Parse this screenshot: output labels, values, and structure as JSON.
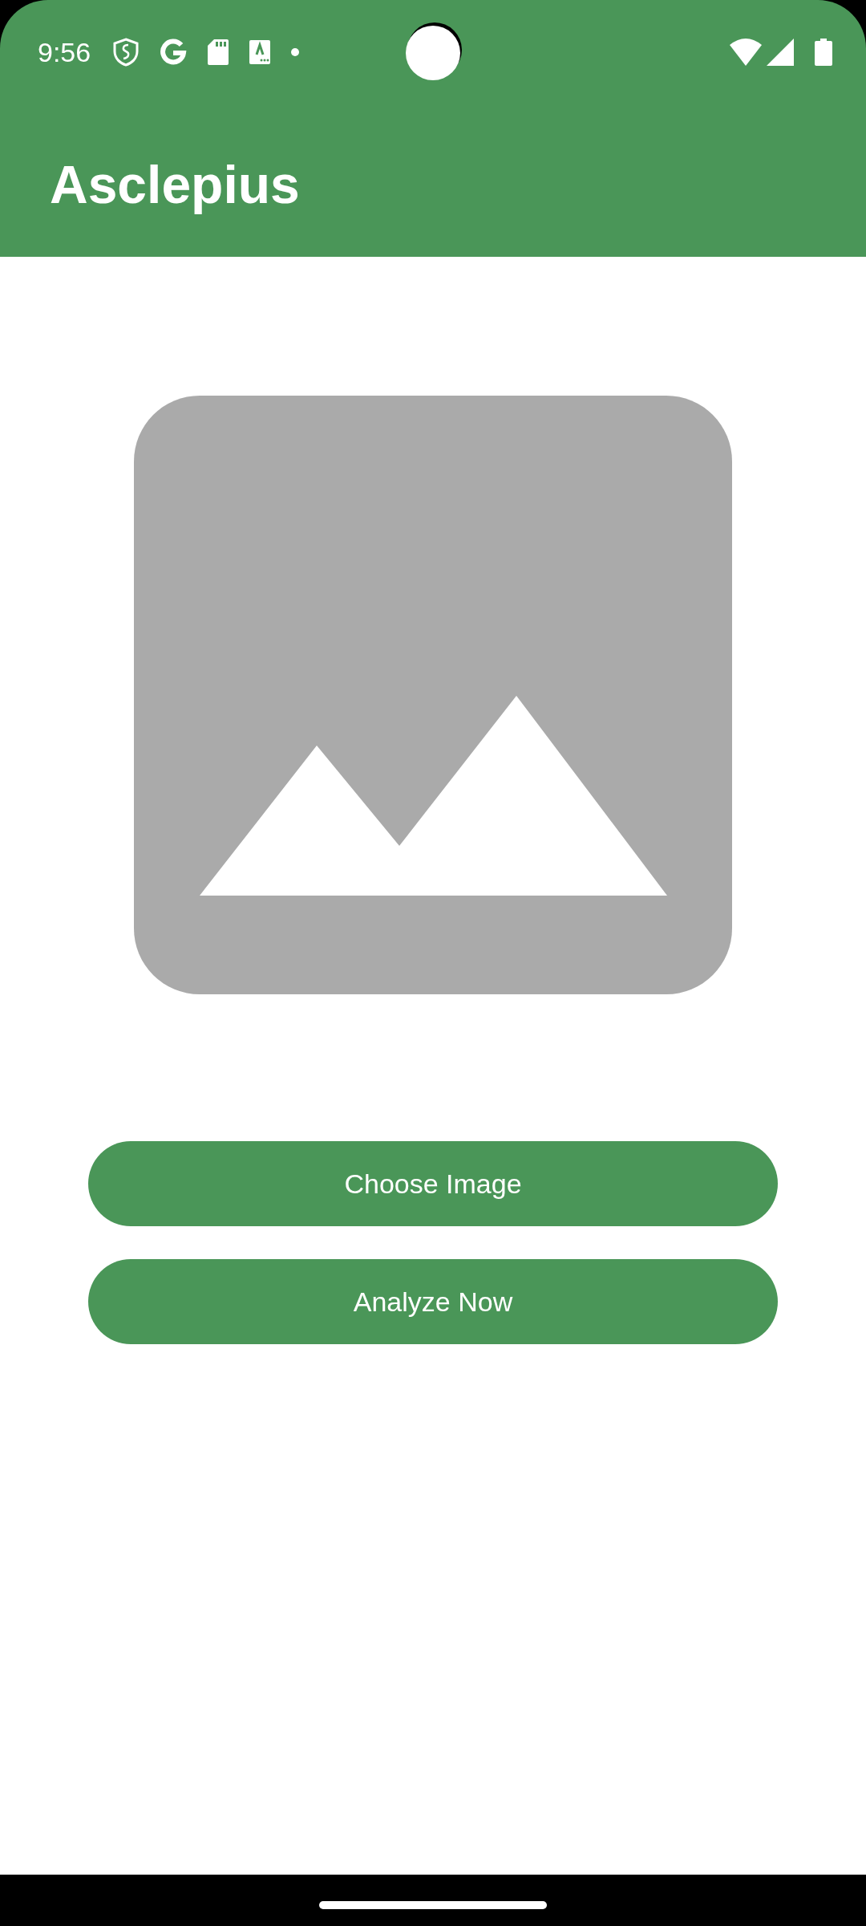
{
  "status_bar": {
    "time": "9:56"
  },
  "app_bar": {
    "title": "Asclepius"
  },
  "buttons": [
    {
      "label": "Choose Image"
    },
    {
      "label": "Analyze Now"
    }
  ]
}
